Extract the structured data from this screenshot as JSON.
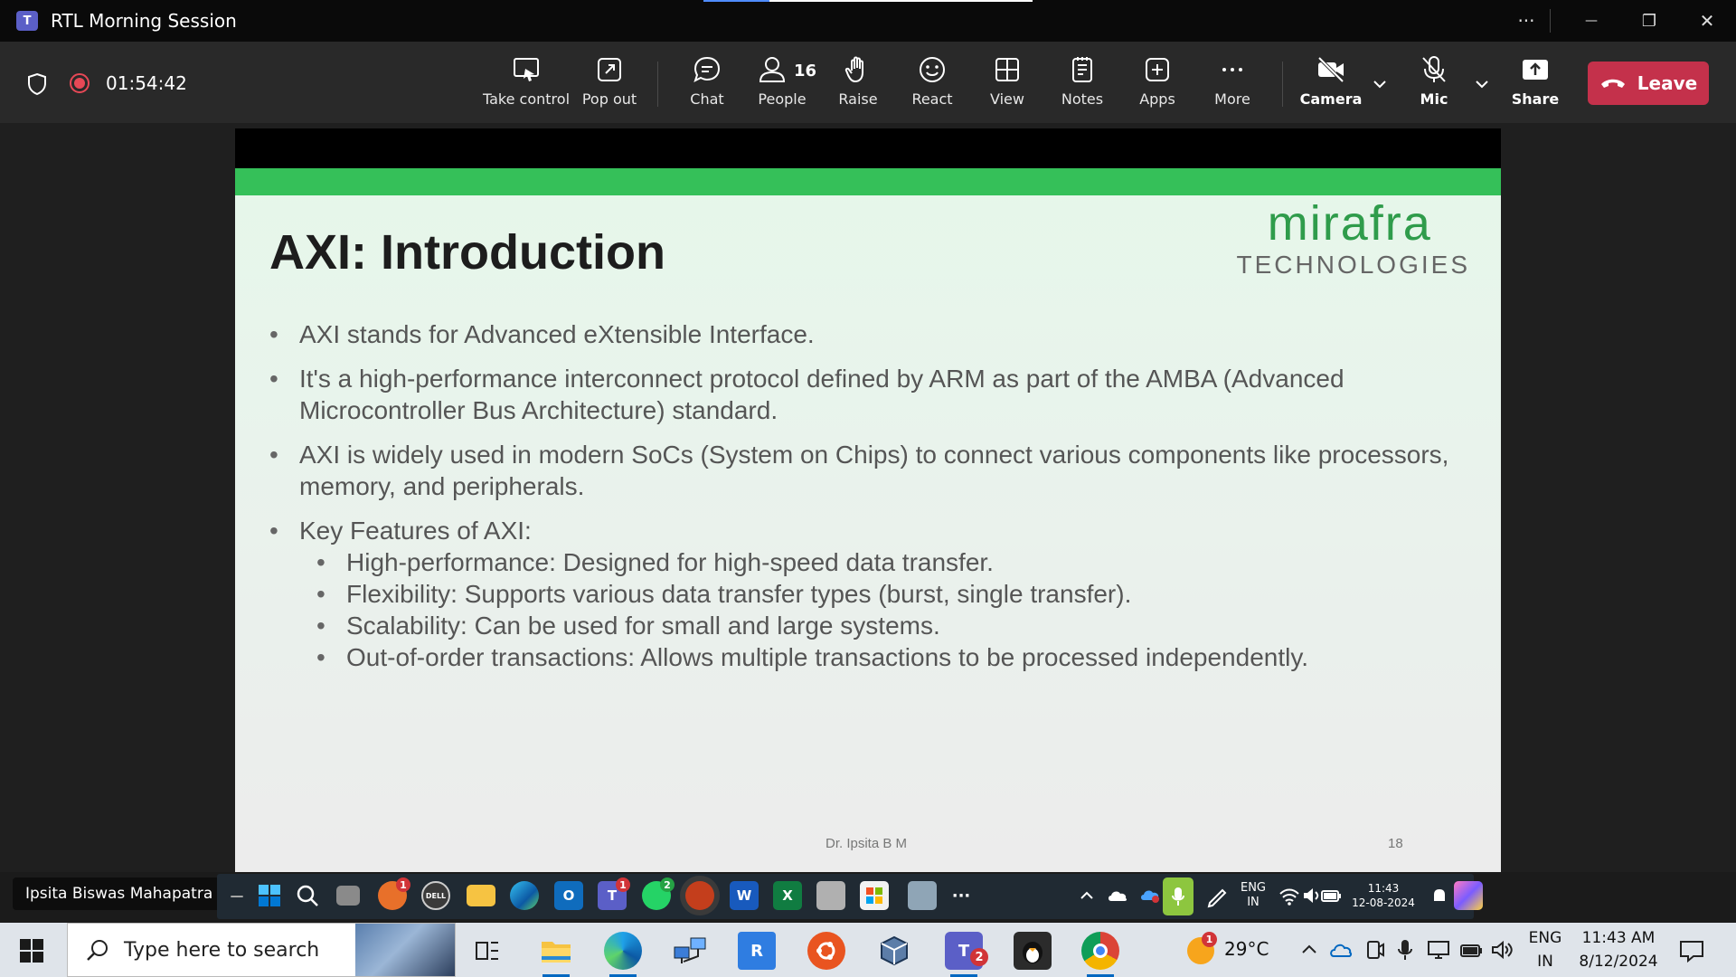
{
  "window": {
    "title": "RTL Morning Session",
    "logo_letter": "T",
    "more_glyph": "···",
    "minimize_glyph": "—",
    "restore_glyph": "❐",
    "close_glyph": "✕",
    "progress_fraction": 0.2
  },
  "toolbar": {
    "timer": "01:54:42",
    "take_control": "Take control",
    "pop_out": "Pop out",
    "chat": "Chat",
    "people": "People",
    "people_count": "16",
    "raise": "Raise",
    "react": "React",
    "view": "View",
    "notes": "Notes",
    "apps": "Apps",
    "more": "More",
    "camera": "Camera",
    "mic": "Mic",
    "share": "Share",
    "leave": "Leave"
  },
  "slide": {
    "title": "AXI: Introduction",
    "brand_name": "mirafra",
    "brand_sub": "TECHNOLOGIES",
    "bullets": [
      "AXI stands for Advanced eXtensible Interface.",
      "It's a high-performance interconnect protocol defined by ARM as part of the AMBA (Advanced Microcontroller Bus Architecture) standard.",
      "AXI is widely used in modern SoCs (System on Chips) to connect various components like processors, memory, and peripherals.",
      "Key Features of AXI:"
    ],
    "sub_bullets": [
      "High-performance: Designed for high-speed data transfer.",
      "Flexibility: Supports various data transfer types (burst, single transfer).",
      "Scalability: Can be used for small and large systems.",
      "Out-of-order transactions: Allows multiple transactions to be processed independently."
    ],
    "footer_name": "Dr. Ipsita B M",
    "page_number": "18"
  },
  "remote": {
    "presenter_name": "Ipsita Biswas Mahapatra",
    "lang_top": "ENG",
    "lang_bottom": "IN",
    "time": "11:43",
    "date": "12-08-2024",
    "dell_label": "DELL",
    "word_label": "W",
    "excel_label": "X",
    "outlook_label": "O",
    "teams_label": "T",
    "more_glyph": "···",
    "badge_copilot": "1",
    "badge_teams": "1",
    "badge_whatsapp": "2"
  },
  "taskbar": {
    "search_placeholder": "Type here to search",
    "weather_temp": "29°C",
    "weather_badge": "1",
    "teams_badge": "2",
    "lang_top": "ENG",
    "lang_bottom": "IN",
    "time": "11:43 AM",
    "date": "8/12/2024",
    "chevron_glyph": "^"
  },
  "colors": {
    "leave": "#c4314b",
    "slide_band": "#35c059",
    "brand_green": "#2f9c4b",
    "recording": "#e74856"
  }
}
